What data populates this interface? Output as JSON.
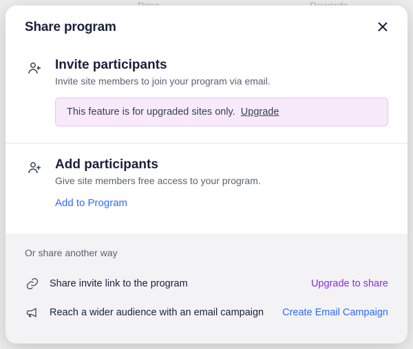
{
  "background_ghost": {
    "price": "Price",
    "rewards": "Rewards"
  },
  "modal": {
    "title": "Share program"
  },
  "invite": {
    "title": "Invite participants",
    "subtitle": "Invite site members to join your program via email.",
    "notice_text": "This feature is for upgraded sites only.",
    "upgrade_label": "Upgrade"
  },
  "add": {
    "title": "Add participants",
    "subtitle": "Give site members free access to your program.",
    "action_label": "Add to Program"
  },
  "other": {
    "heading": "Or share another way",
    "rows": [
      {
        "label": "Share invite link to the program",
        "action": "Upgrade to share",
        "action_style": "purple",
        "icon": "link"
      },
      {
        "label": "Reach a wider audience with an email campaign",
        "action": "Create Email Campaign",
        "action_style": "blue",
        "icon": "megaphone"
      }
    ]
  }
}
